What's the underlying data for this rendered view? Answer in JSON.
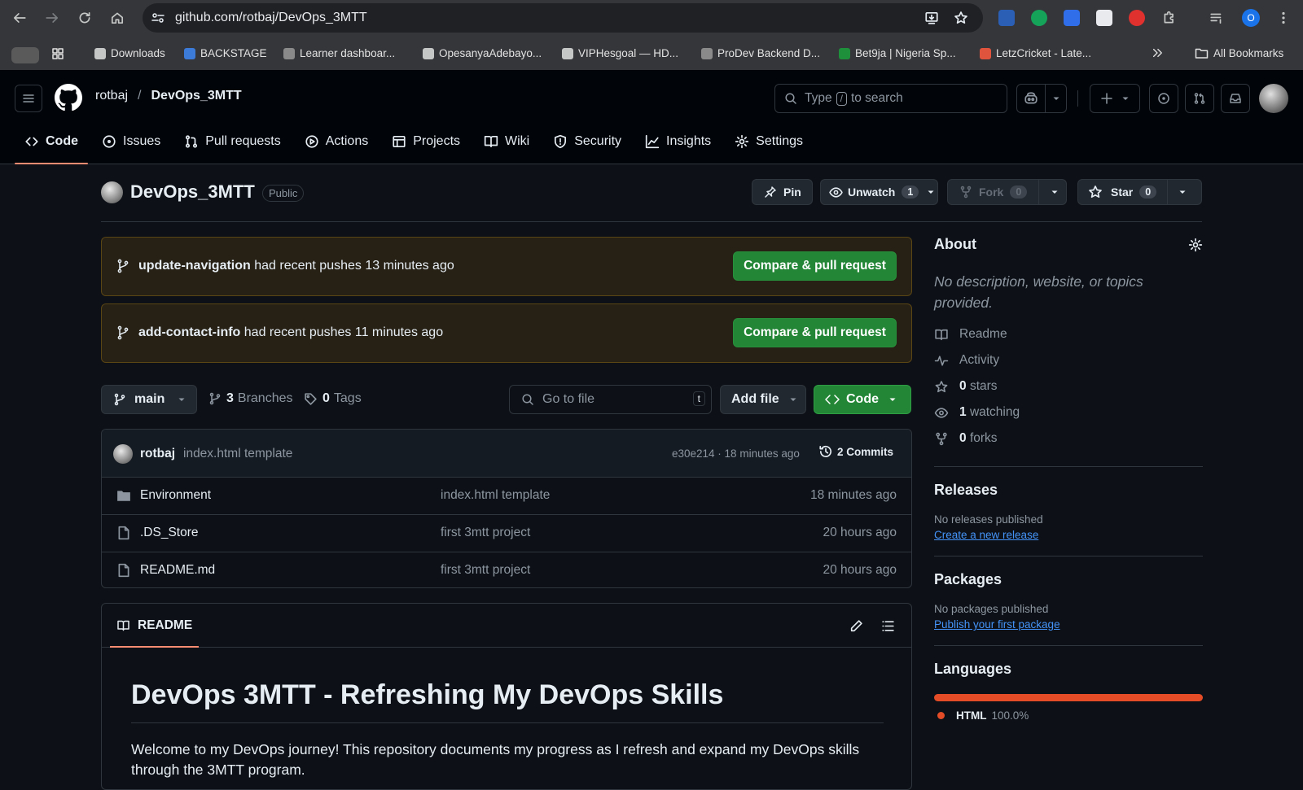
{
  "browser": {
    "url": "github.com/rotbaj/DevOps_3MTT",
    "bookmarks": [
      {
        "label": "Downloads",
        "color": "#c4c7c5"
      },
      {
        "label": "BACKSTAGE",
        "color": "#3d7bd9"
      },
      {
        "label": "Learner dashboar...",
        "color": "#8a8a8a"
      },
      {
        "label": "OpesanyaAdebayo...",
        "color": "#c4c7c5"
      },
      {
        "label": "VIPHesgoal — HD...",
        "color": "#c4c7c5"
      },
      {
        "label": "ProDev Backend D...",
        "color": "#8a8a8a"
      },
      {
        "label": "Bet9ja | Nigeria Sp...",
        "color": "#1e8f3a"
      },
      {
        "label": "LetzCricket - Late...",
        "color": "#e0533c"
      }
    ],
    "all_bookmarks": "All Bookmarks",
    "profile_initial": "O"
  },
  "header": {
    "owner": "rotbaj",
    "separator": "/",
    "repo": "DevOps_3MTT",
    "search_prefix": "Type",
    "search_key": "/",
    "search_suffix": "to search"
  },
  "tabs": [
    {
      "label": "Code",
      "icon": "code-icon"
    },
    {
      "label": "Issues",
      "icon": "issue-icon"
    },
    {
      "label": "Pull requests",
      "icon": "pull-request-icon"
    },
    {
      "label": "Actions",
      "icon": "play-icon"
    },
    {
      "label": "Projects",
      "icon": "table-icon"
    },
    {
      "label": "Wiki",
      "icon": "book-icon"
    },
    {
      "label": "Security",
      "icon": "shield-icon"
    },
    {
      "label": "Insights",
      "icon": "graph-icon"
    },
    {
      "label": "Settings",
      "icon": "gear-icon"
    }
  ],
  "repo": {
    "name": "DevOps_3MTT",
    "visibility": "Public",
    "pin_label": "Pin",
    "unwatch_label": "Unwatch",
    "watch_count": "1",
    "fork_label": "Fork",
    "fork_count": "0",
    "star_label": "Star",
    "star_count": "0"
  },
  "banners": [
    {
      "branch": "update-navigation",
      "text": "had recent pushes 13 minutes ago",
      "button": "Compare & pull request"
    },
    {
      "branch": "add-contact-info",
      "text": "had recent pushes 11 minutes ago",
      "button": "Compare & pull request"
    }
  ],
  "file_nav": {
    "branch": "main",
    "branches_count": "3",
    "branches_label": "Branches",
    "tags_count": "0",
    "tags_label": "Tags",
    "goto_placeholder": "Go to file",
    "goto_key": "t",
    "add_file": "Add file",
    "code_button": "Code"
  },
  "latest_commit": {
    "author": "rotbaj",
    "message": "index.html template",
    "meta": "e30e214 · 18 minutes ago",
    "commits": "2 Commits"
  },
  "files": [
    {
      "name": "Environment",
      "type": "folder",
      "message": "index.html template",
      "age": "18 minutes ago"
    },
    {
      "name": ".DS_Store",
      "type": "file",
      "message": "first 3mtt project",
      "age": "20 hours ago"
    },
    {
      "name": "README.md",
      "type": "file",
      "message": "first 3mtt project",
      "age": "20 hours ago"
    }
  ],
  "readme": {
    "tab_label": "README",
    "title": "DevOps 3MTT - Refreshing My DevOps Skills",
    "paragraph": "Welcome to my DevOps journey! This repository documents my progress as I refresh and expand my DevOps skills through the 3MTT program."
  },
  "about": {
    "heading": "About",
    "description": "No description, website, or topics provided.",
    "readme": "Readme",
    "activity": "Activity",
    "stars_count": "0",
    "stars_label": "stars",
    "watching_count": "1",
    "watching_label": "watching",
    "forks_count": "0",
    "forks_label": "forks"
  },
  "releases": {
    "heading": "Releases",
    "empty": "No releases published",
    "link": "Create a new release"
  },
  "packages": {
    "heading": "Packages",
    "empty": "No packages published",
    "link": "Publish your first package"
  },
  "languages": {
    "heading": "Languages",
    "name": "HTML",
    "percent": "100.0%",
    "color": "#e34c26",
    "share": 1.0
  }
}
